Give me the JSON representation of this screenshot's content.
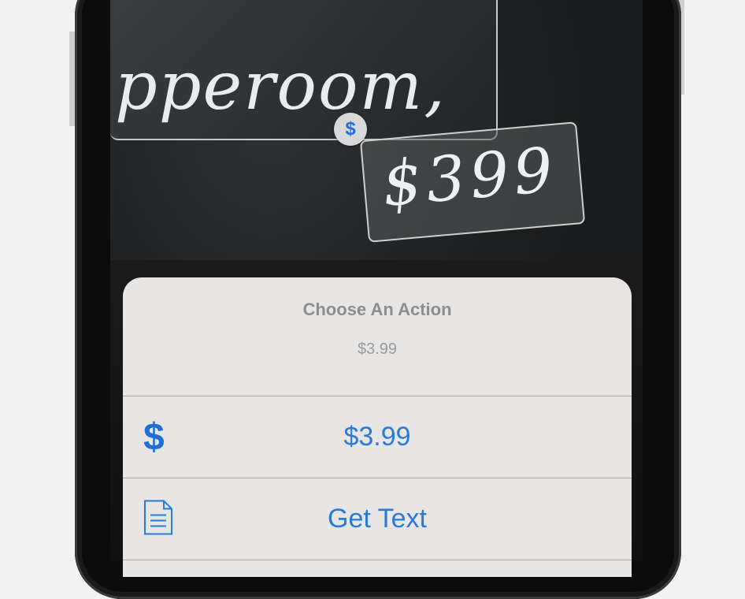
{
  "camera_view": {
    "sign_text": "pperoom,",
    "price_text": "$399",
    "detected_badge_symbol": "$"
  },
  "action_sheet": {
    "title": "Choose An Action",
    "subtitle": "$3.99",
    "actions": [
      {
        "label": "$3.99",
        "icon": "dollar-icon",
        "icon_glyph": "$"
      },
      {
        "label": "Get Text",
        "icon": "document-icon"
      }
    ]
  },
  "colors": {
    "accent": "#2a7ad8",
    "sheet_background": "#e7e6e5"
  }
}
